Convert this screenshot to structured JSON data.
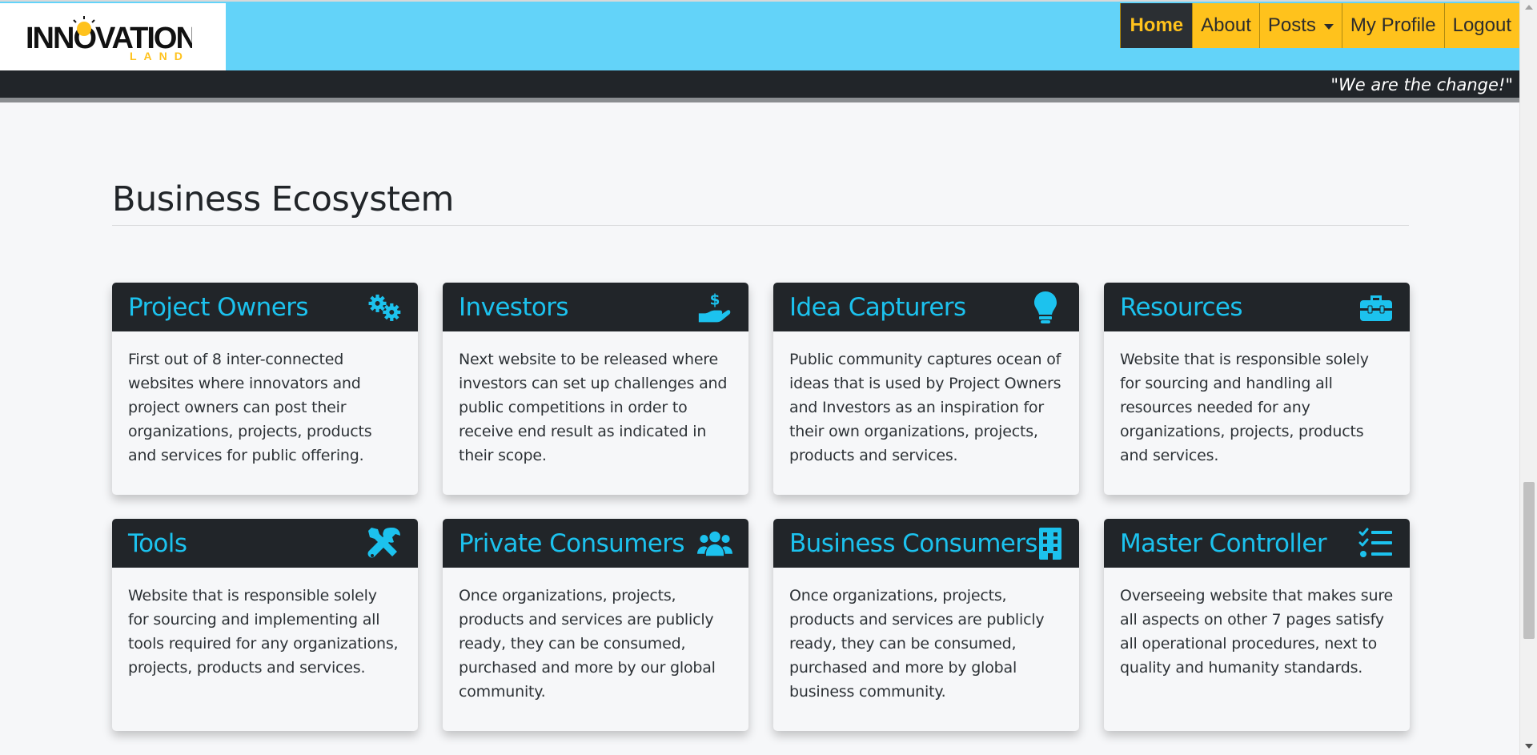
{
  "header": {
    "logo": {
      "line1": "INNOVATION",
      "line2": "LAND"
    },
    "nav": [
      {
        "label": "Home",
        "active": true
      },
      {
        "label": "About"
      },
      {
        "label": "Posts",
        "dropdown": true
      },
      {
        "label": "My Profile"
      },
      {
        "label": "Logout"
      }
    ],
    "tagline": "\"We are the change!\""
  },
  "section": {
    "title": "Business Ecosystem",
    "cards": [
      {
        "title": "Project Owners",
        "icon": "gears-icon",
        "text": "First out of 8 inter-connected websites where innovators and project owners can post their organizations, projects, products and services for public offering."
      },
      {
        "title": "Investors",
        "icon": "hand-dollar-icon",
        "text": "Next website to be released where investors can set up challenges and public competitions in order to receive end result as indicated in their scope."
      },
      {
        "title": "Idea Capturers",
        "icon": "lightbulb-icon",
        "text": "Public community captures ocean of ideas that is used by Project Owners and Investors as an inspiration for their own organizations, projects, products and services."
      },
      {
        "title": "Resources",
        "icon": "toolbox-icon",
        "text": "Website that is responsible solely for sourcing and handling all resources needed for any organizations, projects, products and services."
      },
      {
        "title": "Tools",
        "icon": "tools-icon",
        "text": "Website that is responsible solely for sourcing and implementing all tools required for any organizations, projects, products and services."
      },
      {
        "title": "Private Consumers",
        "icon": "users-icon",
        "text": "Once organizations, projects, products and services are publicly ready, they can be consumed, purchased and more by our global community."
      },
      {
        "title": "Business Consumers",
        "icon": "building-icon",
        "text": "Once organizations, projects, products and services are publicly ready, they can be consumed, purchased and more by global business community."
      },
      {
        "title": "Master Controller",
        "icon": "tasks-icon",
        "text": "Overseeing website that makes sure all aspects on other 7 pages satisfy all operational procedures, next to quality and humanity standards."
      }
    ]
  },
  "colors": {
    "accent": "#1cc2ee",
    "header_bg": "#63d3f9",
    "nav_bg": "#ffc21c",
    "dark": "#212529"
  }
}
